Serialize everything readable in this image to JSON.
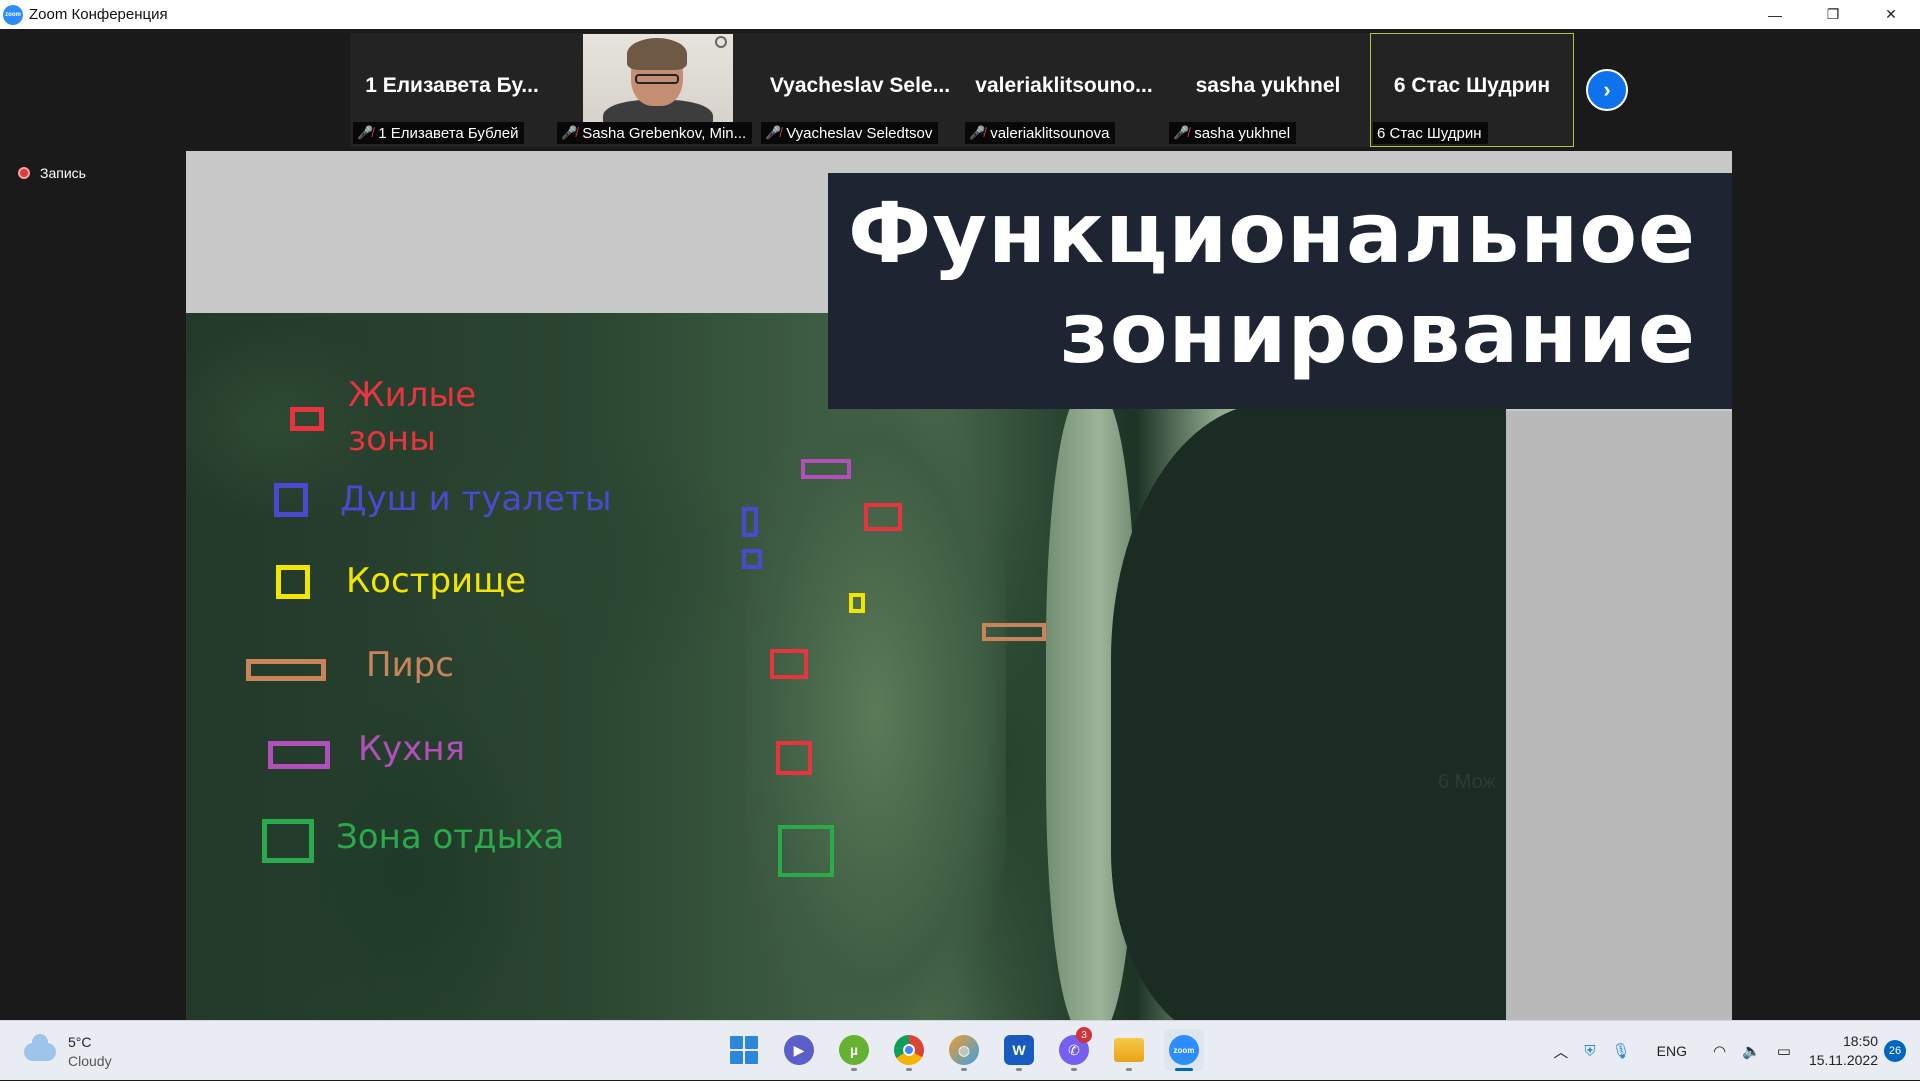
{
  "window": {
    "title": "Zoom Конференция",
    "app_icon_label": "zoom",
    "minimize": "—",
    "restore": "❐",
    "close": "✕"
  },
  "participants": [
    {
      "tile_name": "1 Елизавета Бу...",
      "nameplate": "1 Елизавета Бублей",
      "muted": true
    },
    {
      "tile_name": "",
      "nameplate": "Sasha Grebenkov, Min...",
      "muted": true,
      "has_video": true
    },
    {
      "tile_name": "Vyacheslav Sele...",
      "nameplate": "Vyacheslav Seledtsov",
      "muted": true
    },
    {
      "tile_name": "valeriaklitsouno...",
      "nameplate": "valeriaklitsounova",
      "muted": true
    },
    {
      "tile_name": "sasha yukhnel",
      "nameplate": "sasha yukhnel",
      "muted": true
    },
    {
      "tile_name": "6 Стас Шудрин",
      "nameplate": "6 Стас Шудрин",
      "muted": false,
      "active_speaker": true
    }
  ],
  "next_page_icon": "chevron-right-icon",
  "recording": {
    "label": "Запись"
  },
  "slide": {
    "title_line1": "Функциональное",
    "title_line2": "зонирование",
    "legend": [
      {
        "label": "Жилые",
        "label2": "зоны",
        "color": "#e8343e"
      },
      {
        "label": "Душ и туалеты",
        "color": "#4a4ad0"
      },
      {
        "label": "Кострище",
        "color": "#f2e600"
      },
      {
        "label": "Пирс",
        "color": "#c8845a"
      },
      {
        "label": "Кухня",
        "color": "#b050b8"
      },
      {
        "label": "Зона отдыха",
        "color": "#2aaa4a"
      }
    ],
    "watermark": "6 Мож"
  },
  "taskbar": {
    "weather": {
      "temp": "5°C",
      "condition": "Cloudy"
    },
    "apps": [
      {
        "name": "windows-start",
        "label": ""
      },
      {
        "name": "teams-chat",
        "label": ""
      },
      {
        "name": "utorrent",
        "label": ""
      },
      {
        "name": "chrome",
        "label": ""
      },
      {
        "name": "browser-globe",
        "label": ""
      },
      {
        "name": "word",
        "label": "W"
      },
      {
        "name": "viber",
        "label": "",
        "badge": "3"
      },
      {
        "name": "file-explorer",
        "label": ""
      },
      {
        "name": "zoom",
        "label": "zoom"
      }
    ],
    "tray": {
      "language": "ENG"
    },
    "clock": {
      "time": "18:50",
      "date": "15.11.2022"
    },
    "notifications": "26"
  }
}
